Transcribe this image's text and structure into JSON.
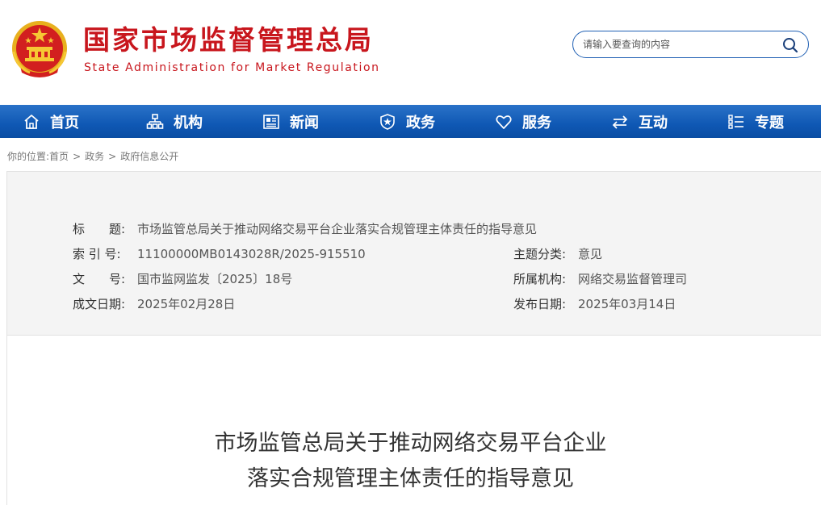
{
  "header": {
    "title": "国家市场监督管理总局",
    "subtitle": "State Administration for Market Regulation",
    "emblem_icon": "national-emblem-icon",
    "search": {
      "placeholder": "请输入要查询的内容"
    }
  },
  "nav": {
    "items": [
      {
        "label": "首页",
        "icon": "home-icon"
      },
      {
        "label": "机构",
        "icon": "org-chart-icon"
      },
      {
        "label": "新闻",
        "icon": "newspaper-icon"
      },
      {
        "label": "政务",
        "icon": "shield-icon"
      },
      {
        "label": "服务",
        "icon": "heart-icon"
      },
      {
        "label": "互动",
        "icon": "exchange-arrows-icon"
      },
      {
        "label": "专题",
        "icon": "list-icon"
      }
    ]
  },
  "breadcrumb": {
    "prefix": "你的位置:",
    "items": [
      "首页",
      "政务",
      "政府信息公开"
    ],
    "separator": ">"
  },
  "meta": {
    "title_label": "标　　题:",
    "title_value": "市场监管总局关于推动网络交易平台企业落实合规管理主体责任的指导意见",
    "index_label": "索 引 号:",
    "index_value": "11100000MB0143028R/2025-915510",
    "topic_label": "主题分类:",
    "topic_value": "意见",
    "docno_label": "文　　号:",
    "docno_value": "国市监网监发〔2025〕18号",
    "org_label": "所属机构:",
    "org_value": "网络交易监督管理司",
    "date_label": "成文日期:",
    "date_value": "2025年02月28日",
    "publish_label": "发布日期:",
    "publish_value": "2025年03月14日"
  },
  "doc": {
    "title_line1": "市场监管总局关于推动网络交易平台企业",
    "title_line2": "落实合规管理主体责任的指导意见"
  },
  "colors": {
    "brand_red": "#c8161d",
    "nav_blue": "#0f58b4",
    "search_border": "#1f5fb3"
  }
}
